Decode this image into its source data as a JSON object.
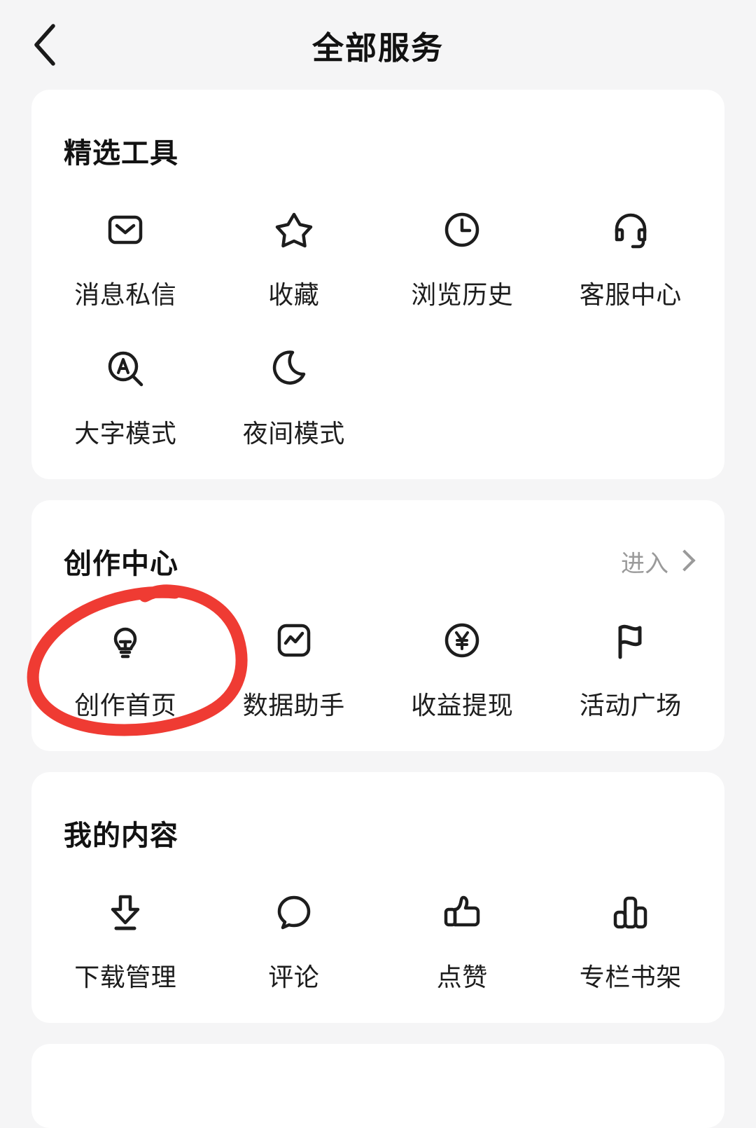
{
  "header": {
    "title": "全部服务",
    "back_icon": "chevron-left-icon"
  },
  "sections": [
    {
      "id": "featured-tools",
      "title": "精选工具",
      "action_label": null,
      "items": [
        {
          "label": "消息私信",
          "icon": "envelope-icon"
        },
        {
          "label": "收藏",
          "icon": "star-icon"
        },
        {
          "label": "浏览历史",
          "icon": "clock-icon"
        },
        {
          "label": "客服中心",
          "icon": "headset-icon"
        },
        {
          "label": "大字模式",
          "icon": "magnifier-a-icon"
        },
        {
          "label": "夜间模式",
          "icon": "moon-icon"
        }
      ]
    },
    {
      "id": "creation-center",
      "title": "创作中心",
      "action_label": "进入",
      "items": [
        {
          "label": "创作首页",
          "icon": "lightbulb-icon"
        },
        {
          "label": "数据助手",
          "icon": "trendline-square-icon"
        },
        {
          "label": "收益提现",
          "icon": "yuan-circle-icon"
        },
        {
          "label": "活动广场",
          "icon": "flag-icon"
        }
      ]
    },
    {
      "id": "my-content",
      "title": "我的内容",
      "action_label": null,
      "items": [
        {
          "label": "下载管理",
          "icon": "download-icon"
        },
        {
          "label": "评论",
          "icon": "speech-bubble-icon"
        },
        {
          "label": "点赞",
          "icon": "thumbs-up-icon"
        },
        {
          "label": "专栏书架",
          "icon": "bookshelf-bars-icon"
        }
      ]
    }
  ],
  "annotation": {
    "type": "hand-drawn-circle",
    "color": "#ef3b33",
    "target_label": "创作首页"
  },
  "colors": {
    "background": "#f5f5f6",
    "card": "#ffffff",
    "text_primary": "#121212",
    "text_muted": "#9a9a9a",
    "annotation_red": "#ef3b33"
  }
}
